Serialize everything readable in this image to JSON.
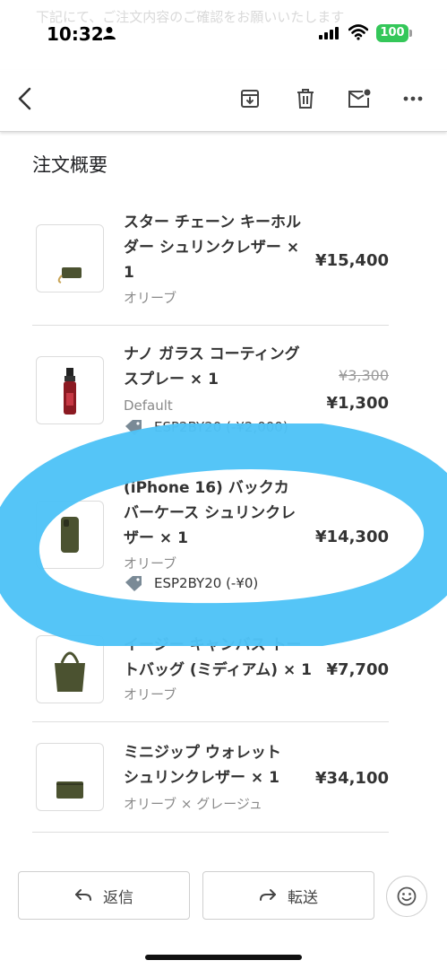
{
  "status": {
    "time": "10:32",
    "battery": "100",
    "background_text": "下記にて、ご注文内容のご確認をお願いいたします"
  },
  "toolbar": {
    "icons": [
      "back-arrow-icon",
      "archive-icon",
      "trash-icon",
      "mark-unread-icon",
      "more-icon"
    ]
  },
  "section_title": "注文概要",
  "items": [
    {
      "name_lines": [
        "スター チェーン キーホル",
        "ダー シュリンクレザー ×",
        "1"
      ],
      "variant": "オリーブ",
      "price": "¥15,400"
    },
    {
      "name_lines": [
        "ナノ ガラス コーティング",
        "スプレー × 1"
      ],
      "variant": "Default",
      "original_price": "¥3,300",
      "price": "¥1,300",
      "discount": "ESP2BY20 (-¥2,000)"
    },
    {
      "name_lines": [
        "(iPhone 16) バックカ",
        "バーケース シュリンクレ",
        "ザー × 1"
      ],
      "variant": "オリーブ",
      "price": "¥14,300",
      "discount": "ESP2BY20 (-¥0)"
    },
    {
      "name_lines": [
        "イージー キャンバス トー",
        "トバッグ (ミディアム) × 1"
      ],
      "variant": "オリーブ",
      "price": "¥7,700"
    },
    {
      "name_lines": [
        "ミニジップ ウォレット",
        "シュリンクレザー × 1"
      ],
      "variant": "オリーブ × グレージュ",
      "price": "¥34,100"
    }
  ],
  "actions": {
    "reply_label": "返信",
    "forward_label": "転送"
  },
  "colors": {
    "highlight": "#4fc3f7",
    "battery": "#34c759",
    "product_olive": "#4b5230"
  }
}
